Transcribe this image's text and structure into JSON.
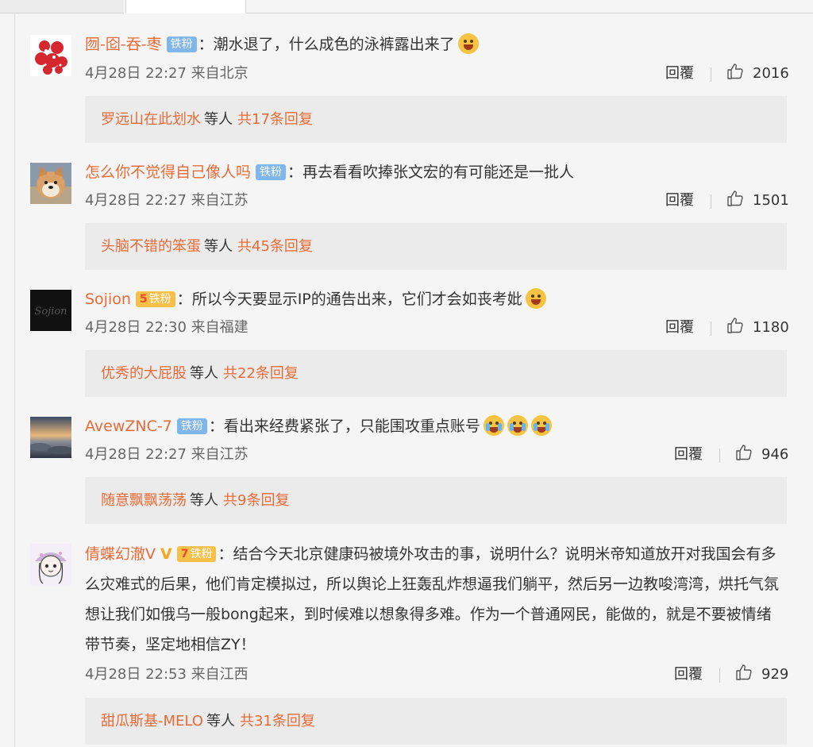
{
  "comments": [
    {
      "username": "囫-囵-吞-枣",
      "badge": "铁粉",
      "text": "潮水退了，什么成色的泳裤露出来了",
      "emojis": [
        "grin"
      ],
      "time": "4月28日 22:27 来自北京",
      "reply_label": "回覆",
      "likes": "2016",
      "replies": {
        "name": "罗远山在此划水",
        "who": "等人",
        "count": "共17条回复"
      }
    },
    {
      "username": "怎么你不觉得自己像人吗",
      "badge": "铁粉",
      "text": "再去看看吹捧张文宏的有可能还是一批人",
      "emojis": [],
      "time": "4月28日 22:27 来自江苏",
      "reply_label": "回覆",
      "likes": "1501",
      "replies": {
        "name": "头脑不错的笨蛋",
        "who": "等人",
        "count": "共45条回复"
      }
    },
    {
      "username": "Sojion",
      "badge": "铁粉",
      "badge_level": "5",
      "text": "所以今天要显示IP的通告出来，它们才会如丧考妣",
      "emojis": [
        "laugh-tears"
      ],
      "time": "4月28日 22:30 来自福建",
      "reply_label": "回覆",
      "likes": "1180",
      "replies": {
        "name": "优秀的大屁股",
        "who": "等人",
        "count": "共22条回复"
      }
    },
    {
      "username": "AvewZNC-7",
      "badge": "铁粉",
      "text": "看出来经费紧张了，只能围攻重点账号",
      "emojis": [
        "cry",
        "cry",
        "cry"
      ],
      "time": "4月28日 22:27 来自江苏",
      "reply_label": "回覆",
      "likes": "946",
      "replies": {
        "name": "随意飘飘荡荡",
        "who": "等人",
        "count": "共9条回复"
      }
    },
    {
      "username": "倩蝶幻澈V",
      "badge": "铁粉",
      "badge_level": "7",
      "text": "结合今天北京健康码被境外攻击的事，说明什么？说明米帝知道放开对我国会有多么灾难式的后果，他们肯定模拟过，所以舆论上狂轰乱炸想逼我们躺平，然后另一边教唆湾湾，烘托气氛想让我们如俄乌一般bong起来，到时候难以想象得多难。作为一个普通网民，能做的，就是不要被情绪带节奏，坚定地相信ZY！",
      "emojis": [],
      "time": "4月28日 22:53 来自江西",
      "reply_label": "回覆",
      "likes": "929",
      "replies": {
        "name": "甜瓜斯基-MELO",
        "who": "等人",
        "count": "共31条回复"
      }
    }
  ],
  "colors": {
    "username": "#e86b37",
    "badge_blue": "#7fb6ec",
    "badge_gold": "#f6c04a",
    "reply_bg": "#ebebeb",
    "page_bg": "#f5f5f5"
  },
  "icons": [
    "thumbs-up-icon",
    "avatar-image",
    "emoji"
  ]
}
